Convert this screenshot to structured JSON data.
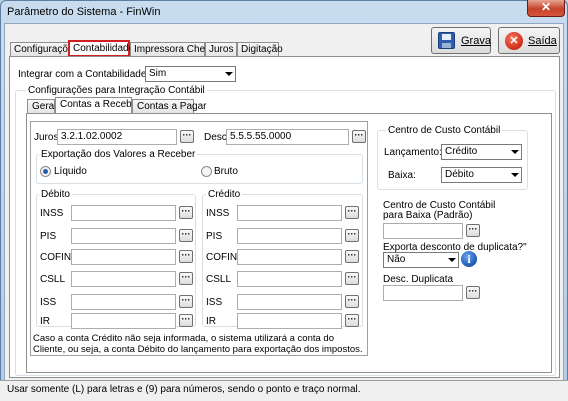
{
  "window": {
    "title": "Parâmetro do Sistema - FinWin",
    "close_glyph": "✕"
  },
  "toolbar": {
    "save_label": "Grava",
    "exit_label": "Saída"
  },
  "tabs": [
    "Configurações",
    "Contabilidade",
    "Impressora Cheque",
    "Juros",
    "Digitação"
  ],
  "integrate": {
    "label": "Integrar com a Contabilidade ?",
    "value": "Sim"
  },
  "integration_group": {
    "title": "Configurações para Integração Contábil"
  },
  "subtabs": [
    "Geral",
    "Contas a Receber",
    "Contas a Pagar"
  ],
  "juros": {
    "label": "Juros",
    "value": "3.2.1.02.0002"
  },
  "desc": {
    "label": "Desc.",
    "value": "5.5.5.55.0000"
  },
  "export_values": {
    "title": "Exportação dos Valores a Receber",
    "liquid": "Líquido",
    "gross": "Bruto"
  },
  "debit": {
    "title": "Débito",
    "fields": [
      "INSS",
      "PIS",
      "COFINS",
      "CSLL",
      "ISS",
      "IR"
    ]
  },
  "credit": {
    "title": "Crédito",
    "fields": [
      "INSS",
      "PIS",
      "COFINS",
      "CSLL",
      "ISS",
      "IR"
    ]
  },
  "note": "Caso a conta Crédito não seja informada, o sistema utilizará a conta do Cliente, ou seja, a conta Débito do lançamento para exportação dos impostos.",
  "cost_center": {
    "title": "Centro de Custo Contábil",
    "launch_label": "Lançamento:",
    "launch_value": "Crédito",
    "settle_label": "Baixa:",
    "settle_value": "Débito"
  },
  "default_cc": {
    "label_line1": "Centro de Custo Contábil",
    "label_line2": "para Baixa (Padrão)"
  },
  "export_discount": {
    "label": "Exporta desconto de duplicata?\"",
    "value": "Não",
    "info_glyph": "i"
  },
  "dup_discount": {
    "label": "Desc. Duplicata"
  },
  "status": "Usar somente (L) para letras e (9) para números, sendo o ponto e traço normal.",
  "colors": {
    "active_tab_border": "#d11f1f",
    "exit_icon": "#d9351f",
    "save_icon": "#2f5fb0",
    "info_icon": "#1e5fb8"
  }
}
